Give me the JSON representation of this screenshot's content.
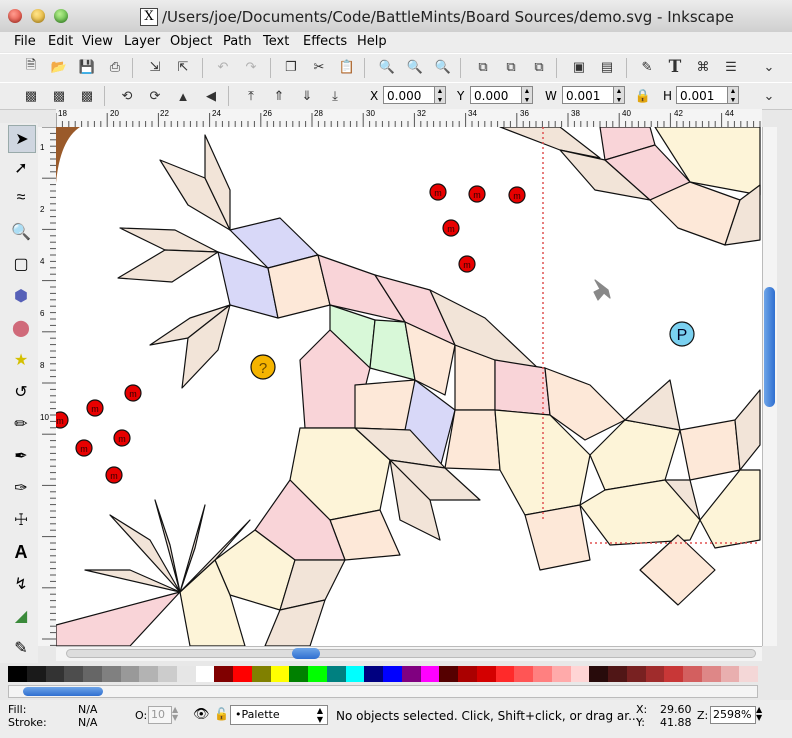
{
  "window": {
    "app_icon": "X",
    "title": "/Users/joe/Documents/Code/BattleMints/Board Sources/demo.svg - Inkscape"
  },
  "menu": [
    "File",
    "Edit",
    "View",
    "Layer",
    "Object",
    "Path",
    "Text",
    "Effects",
    "Help"
  ],
  "toolbar": {
    "icons": [
      "new-document-icon",
      "open-icon",
      "save-icon",
      "print-icon",
      "import-icon",
      "export-icon",
      "undo-icon",
      "redo-icon",
      "copy-icon",
      "cut-icon",
      "paste-icon",
      "zoom-selection-icon",
      "zoom-drawing-icon",
      "zoom-page-icon",
      "duplicate-icon",
      "clone-icon",
      "unlink-clone-icon",
      "group-icon",
      "ungroup-icon",
      "fill-stroke-icon",
      "text-icon",
      "xml-editor-icon",
      "align-icon",
      "more-icon"
    ]
  },
  "controls": {
    "x_label": "X",
    "x_value": "0.000",
    "y_label": "Y",
    "y_value": "0.000",
    "w_label": "W",
    "w_value": "0.001",
    "h_label": "H",
    "h_value": "0.001"
  },
  "ruler_h": [
    "18",
    "20",
    "22",
    "24",
    "26",
    "28",
    "30",
    "32",
    "34",
    "36",
    "38",
    "40",
    "42",
    "44"
  ],
  "ruler_v": [
    "1",
    "2",
    "4",
    "6",
    "8",
    "10"
  ],
  "canvas": {
    "mint_label": "m",
    "question_label": "?",
    "p_label": "P"
  },
  "palette_colors": [
    "#000000",
    "#1a1a1a",
    "#333333",
    "#4d4d4d",
    "#666666",
    "#808080",
    "#999999",
    "#b3b3b3",
    "#cccccc",
    "#e6e6e6",
    "#ffffff",
    "#800000",
    "#ff0000",
    "#808000",
    "#ffff00",
    "#008000",
    "#00ff00",
    "#008080",
    "#00ffff",
    "#000080",
    "#0000ff",
    "#800080",
    "#ff00ff",
    "#550000",
    "#aa0000",
    "#d40000",
    "#ff2a2a",
    "#ff5555",
    "#ff8080",
    "#ffaaaa",
    "#ffd5d5",
    "#280b0b",
    "#501616",
    "#782121",
    "#a02c2c",
    "#c83737",
    "#d35f5f",
    "#de8787",
    "#e9afaf",
    "#f4d7d7"
  ],
  "status": {
    "fill_label": "Fill:",
    "fill_value": "N/A",
    "stroke_label": "Stroke:",
    "stroke_value": "N/A",
    "opacity_label": "O:",
    "opacity_value": "10",
    "layer_select": "•Palette",
    "message": "No objects selected. Click, Shift+click, or drag ar...",
    "x_label": "X:",
    "x_value": "29.60",
    "y_label": "Y:",
    "y_value": "41.88",
    "zoom_label": "Z:",
    "zoom_value": "2598%"
  }
}
